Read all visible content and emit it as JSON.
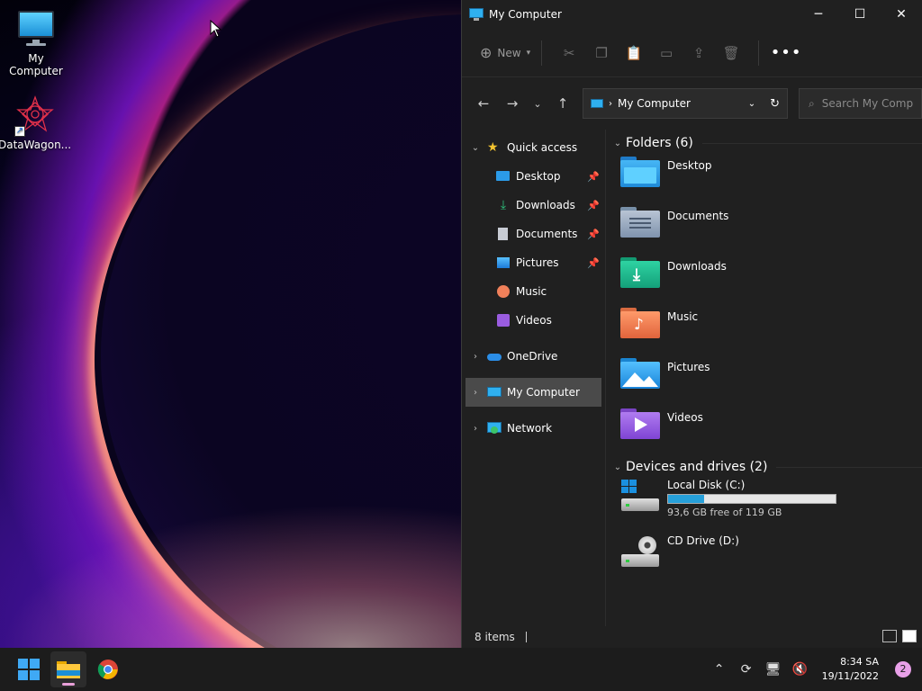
{
  "desktop": {
    "icons": [
      {
        "label": "My Computer",
        "icon": "monitor-icon"
      },
      {
        "label": "DataWagon...",
        "icon": "datawagon-logo-icon"
      }
    ]
  },
  "window": {
    "title": "My Computer",
    "controls": {
      "minimize": "─",
      "maximize": "☐",
      "close": "✕"
    },
    "commandbar": {
      "new_label": "New",
      "icons": [
        "cut-icon",
        "copy-icon",
        "paste-icon",
        "rename-icon",
        "share-icon",
        "delete-icon"
      ],
      "more": "•••"
    },
    "address": {
      "crumb": "My Computer"
    },
    "search": {
      "placeholder": "Search My Comp"
    },
    "sidebar": {
      "quick_access": "Quick access",
      "quick_items": [
        {
          "label": "Desktop",
          "pinned": true
        },
        {
          "label": "Downloads",
          "pinned": true
        },
        {
          "label": "Documents",
          "pinned": true
        },
        {
          "label": "Pictures",
          "pinned": true
        },
        {
          "label": "Music",
          "pinned": false
        },
        {
          "label": "Videos",
          "pinned": false
        }
      ],
      "onedrive": "OneDrive",
      "my_computer": "My Computer",
      "network": "Network"
    },
    "content": {
      "folders_header": "Folders (6)",
      "folders": [
        {
          "label": "Desktop",
          "color": "#2b9be8"
        },
        {
          "label": "Documents",
          "color": "#8aa0b8"
        },
        {
          "label": "Downloads",
          "color": "#1fb88a"
        },
        {
          "label": "Music",
          "color": "#f0805a"
        },
        {
          "label": "Pictures",
          "color": "#2ea6f0"
        },
        {
          "label": "Videos",
          "color": "#9a5ce0"
        }
      ],
      "drives_header": "Devices and drives (2)",
      "drives": [
        {
          "label": "Local Disk (C:)",
          "free": "93,6 GB free of 119 GB",
          "used_fraction": 0.213
        },
        {
          "label": "CD Drive (D:)"
        }
      ]
    },
    "status": {
      "items": "8 items"
    }
  },
  "taskbar": {
    "apps": [
      "windows-start-icon",
      "file-explorer-icon",
      "chrome-icon"
    ],
    "time": "8:34 SA",
    "date": "19/11/2022",
    "notifications": "2"
  }
}
